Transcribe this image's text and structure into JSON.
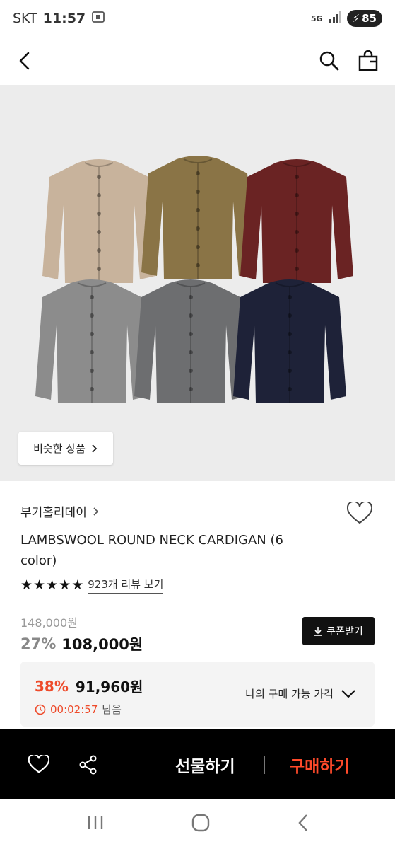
{
  "status_bar": {
    "carrier": "SKT",
    "time": "11:57",
    "network": "5G",
    "battery": "85"
  },
  "hero": {
    "similar_label": "비슷한 상품"
  },
  "product": {
    "brand": "부기홀리데이",
    "title": "LAMBSWOOL ROUND NECK CARDIGAN (6 color)",
    "review_text": "923개 리뷰 보기",
    "rating_stars": 5,
    "original_price": "148,000원",
    "discount": "27%",
    "price": "108,000원",
    "coupon_label": "쿠폰받기"
  },
  "my_price": {
    "discount": "38%",
    "price": "91,960원",
    "timer": "00:02:57",
    "timer_suffix": "남음",
    "label": "나의 구매 가능 가격"
  },
  "action_bar": {
    "gift_label": "선물하기",
    "buy_label": "구매하기"
  },
  "colors": {
    "accent": "#ee4a2a",
    "buy": "#ff4a2a",
    "bar": "#000000"
  },
  "cardigans": [
    {
      "color": "#c8b39c"
    },
    {
      "color": "#8a7446"
    },
    {
      "color": "#6a2323"
    },
    {
      "color": "#8c8c8c"
    },
    {
      "color": "#6d6e70"
    },
    {
      "color": "#1e2238"
    }
  ]
}
